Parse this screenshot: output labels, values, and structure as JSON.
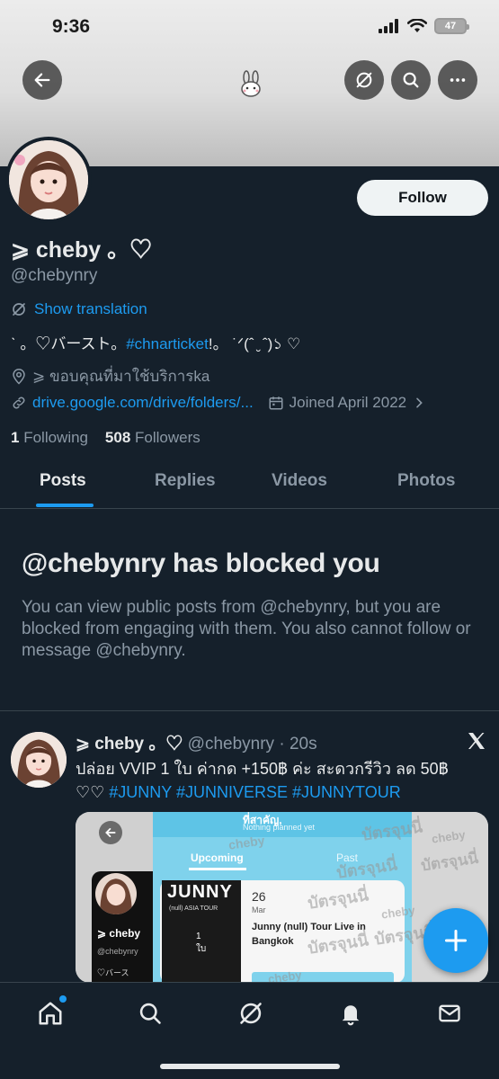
{
  "status_bar": {
    "time": "9:36",
    "battery": "47"
  },
  "header": {
    "back_icon": "arrow-left-icon",
    "center_icon": "bunny-icon",
    "actions": [
      "grok-icon",
      "search-icon",
      "more-icon"
    ]
  },
  "profile": {
    "follow_label": "Follow",
    "display_name": "⩾ cheby 。♡",
    "handle": "@chebynry",
    "show_translation": "Show translation",
    "bio_prefix": "ˋ  。♡バースト。",
    "bio_tag": "#chnarticket",
    "bio_suffix": "!。 ˙ᐟ(ˆ ̮ ˆ)১ ♡",
    "location": "⩾ ขอบคุณที่มาใช้บริการka",
    "link": "drive.google.com/drive/folders/...",
    "joined": "Joined April 2022",
    "following_count": "1",
    "following_label": "Following",
    "followers_count": "508",
    "followers_label": "Followers"
  },
  "tabs": [
    {
      "label": "Posts",
      "active": true
    },
    {
      "label": "Replies",
      "active": false
    },
    {
      "label": "Videos",
      "active": false
    },
    {
      "label": "Photos",
      "active": false
    }
  ],
  "blocked": {
    "title": "@chebynry has blocked you",
    "body": "You can view public posts from @chebynry, but you are blocked from engaging with them. You also cannot follow or message @chebynry."
  },
  "post": {
    "author_name": "⩾ cheby 。♡",
    "author_handle": "@chebynry · 20s",
    "text_line1": "ปล่อย VVIP 1 ใบ ค่ากด +150฿ ค่ะ สะดวกรีวิว ลด 50฿",
    "text_prefix": "♡♡ ",
    "hashtags": [
      "#JUNNY",
      "#JUNNIVERSE",
      "#JUNNYTOUR"
    ],
    "media": {
      "header_text": "Nothing planned yet",
      "header_partial": "ที่สาคัญ,",
      "tab_upcoming": "Upcoming",
      "tab_past": "Past",
      "poster_title": "JUNNY",
      "poster_subtitle": "(null) ASIA TOUR",
      "poster_small": "1\nใบ",
      "event_day": "26",
      "event_month": "Mar",
      "event_title_1": "Junny (null) Tour Live in",
      "event_title_2": "Bangkok",
      "side_name": "⩾ cheby",
      "side_handle": "@chebynry",
      "side_bio": "♡バース",
      "watermark_1": "cheby",
      "watermark_2": "บัตรจุนนี่"
    }
  },
  "fab": {
    "icon": "plus-icon"
  },
  "bottom_nav": [
    "home-icon",
    "search-icon",
    "grok-icon",
    "notifications-icon",
    "messages-icon"
  ]
}
